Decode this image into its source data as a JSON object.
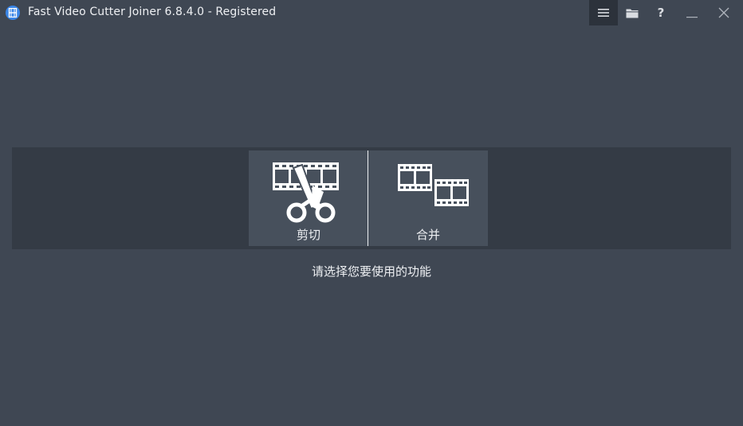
{
  "window": {
    "title": "Fast Video Cutter Joiner 6.8.4.0 - Registered",
    "background": "#3f4753",
    "app_icon": "film-strip-icon",
    "app_icon_color": "#3a86e8"
  },
  "titlebar": {
    "buttons": [
      {
        "name": "menu",
        "icon": "hamburger-menu-icon"
      },
      {
        "name": "open-folder",
        "icon": "folder-icon"
      },
      {
        "name": "help",
        "icon": "question-mark-icon",
        "glyph": "?"
      },
      {
        "name": "minimize",
        "icon": "minimize-icon"
      },
      {
        "name": "close",
        "icon": "close-icon"
      }
    ]
  },
  "features": {
    "cut": {
      "label": "剪切",
      "icon": "film-scissors-icon"
    },
    "join": {
      "label": "合并",
      "icon": "film-join-icon"
    }
  },
  "hint": "请选择您要使用的功能"
}
